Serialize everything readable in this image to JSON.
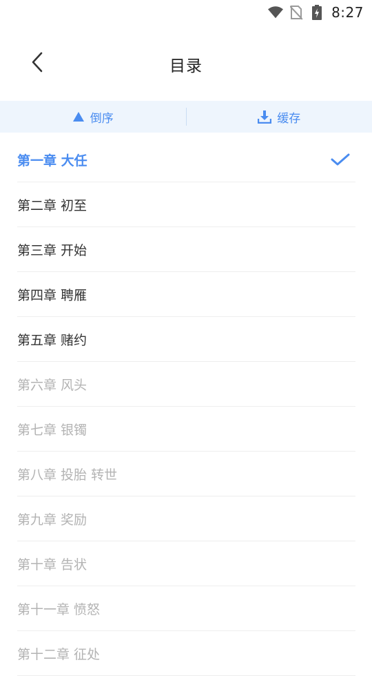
{
  "status_bar": {
    "time": "8:27",
    "icons": [
      "wifi-icon",
      "no-sim-icon",
      "battery-charging-icon"
    ]
  },
  "header": {
    "title": "目录",
    "back_icon": "chevron-left-icon"
  },
  "toolbar": {
    "reverse_label": "倒序",
    "reverse_icon": "triangle-up-icon",
    "cache_label": "缓存",
    "cache_icon": "download-icon"
  },
  "colors": {
    "accent": "#4a8cf0",
    "toolbar_bg": "#eef5fd",
    "text_dark": "#333333",
    "text_muted": "#b3b3b3"
  },
  "chapters": [
    {
      "title": "第一章 大任",
      "state": "current"
    },
    {
      "title": "第二章 初至",
      "state": "normal"
    },
    {
      "title": "第三章 开始",
      "state": "normal"
    },
    {
      "title": "第四章 聘雁",
      "state": "normal"
    },
    {
      "title": "第五章 赌约",
      "state": "normal"
    },
    {
      "title": "第六章 风头",
      "state": "muted"
    },
    {
      "title": "第七章 银镯",
      "state": "muted"
    },
    {
      "title": "第八章 投胎 转世",
      "state": "muted"
    },
    {
      "title": "第九章 奖励",
      "state": "muted"
    },
    {
      "title": "第十章 告状",
      "state": "muted"
    },
    {
      "title": "第十一章 愤怒",
      "state": "muted"
    },
    {
      "title": "第十二章 征处",
      "state": "muted"
    }
  ]
}
